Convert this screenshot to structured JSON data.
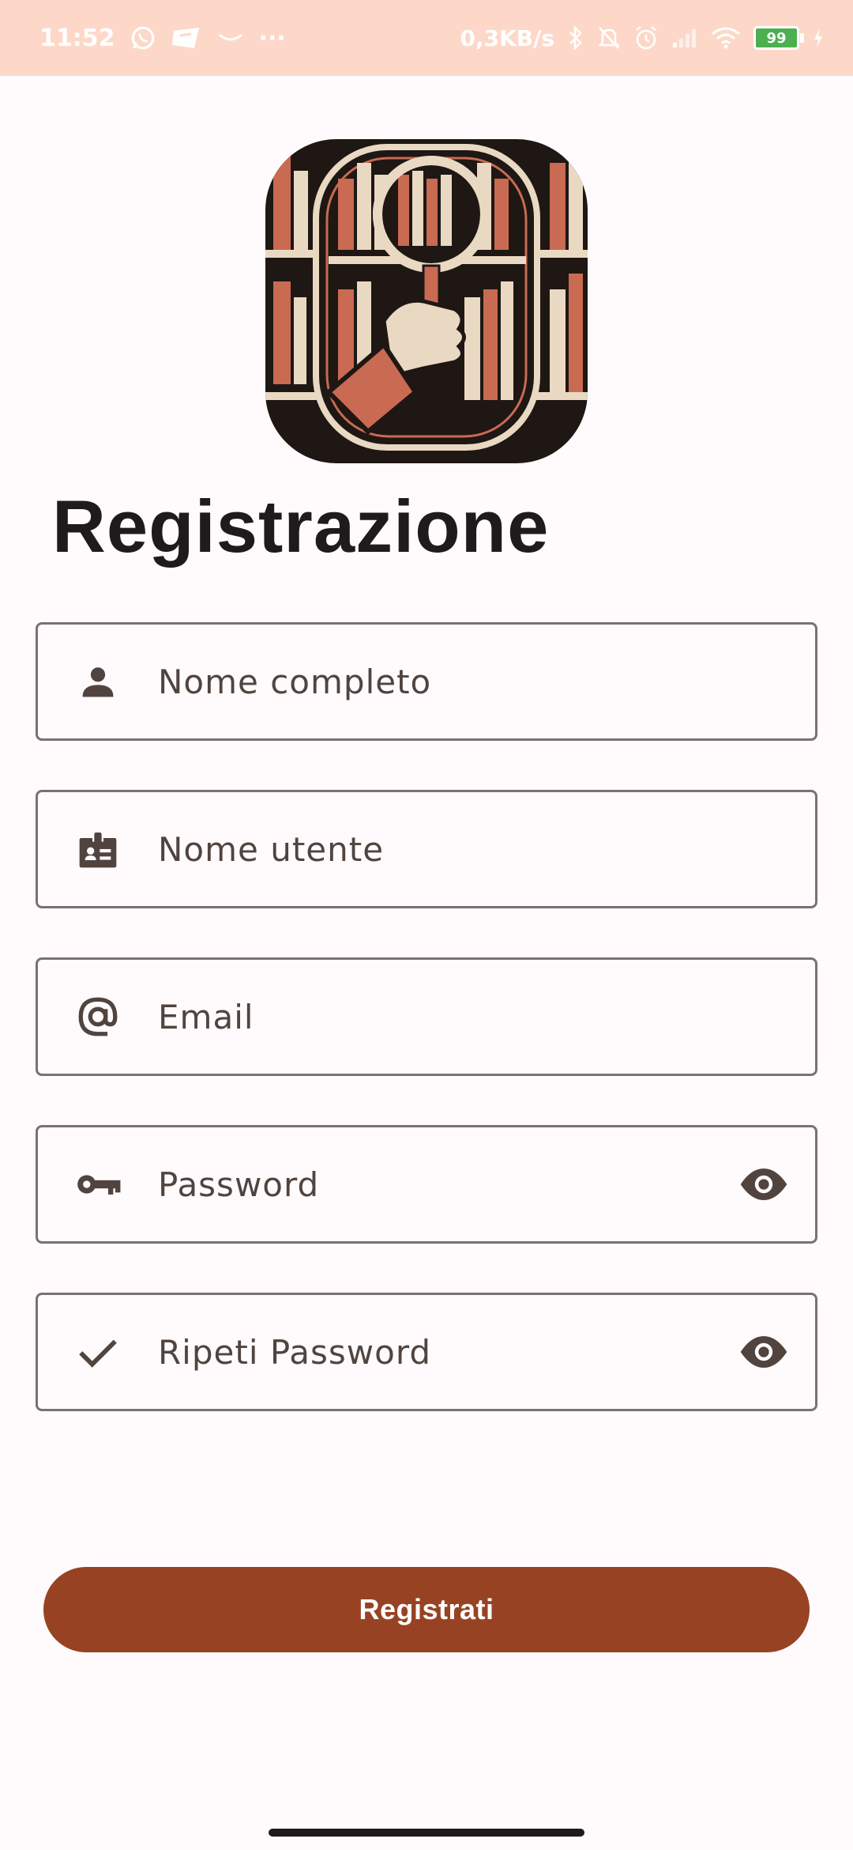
{
  "status_bar": {
    "time": "11:52",
    "dots": "···",
    "network_speed": "0,3KB/s",
    "battery_level": "99"
  },
  "page": {
    "title": "Registrazione"
  },
  "fields": {
    "full_name": "Nome completo",
    "username": "Nome utente",
    "email": "Email",
    "password": "Password",
    "repeat_password": "Ripeti Password"
  },
  "actions": {
    "register_label": "Registrati"
  },
  "colors": {
    "status_bar_bg": "#fdd8c9",
    "accent": "#974323",
    "background": "#fffbfc",
    "outline": "#7b7170",
    "icon": "#51443f"
  },
  "icons": {
    "full_name": "person-icon",
    "username": "badge-icon",
    "email": "at-sign-icon",
    "password": "key-icon",
    "repeat_password": "check-icon",
    "visibility": "eye-icon"
  }
}
